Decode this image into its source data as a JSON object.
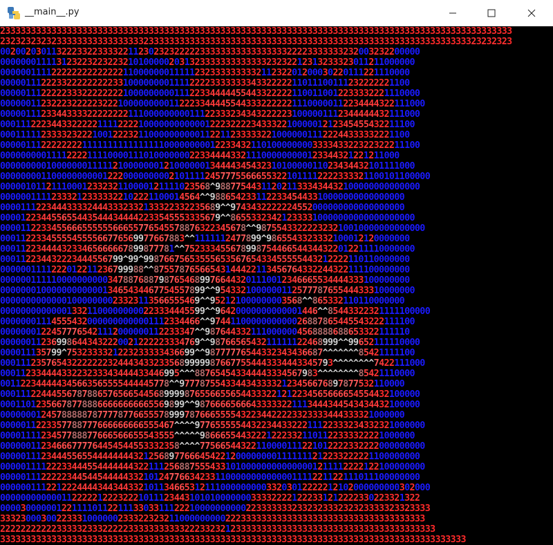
{
  "window": {
    "title": "__main__.py",
    "icon": "python-icon",
    "controls": {
      "minimize": "minimize-icon",
      "maximize": "maximize-icon",
      "close": "close-icon"
    }
  },
  "colors": {
    "background": "#000000",
    "low_digit": "#1a1aff",
    "high_digit": "#ff2a2a",
    "peak_digit": "#d0d0d0"
  },
  "grid": {
    "rows": [
      "2333333333333333333333333333333333333333333333333333333333333333333333333333333333333333333333333333",
      "2323232323233333333333333333233333333333333333333333333333333333333333333333333333333333333323232323",
      "0020020301132223322333322112302323222223333333333333333322223333333232003232200000",
      "000000011113123223223223210100000203132333333333333323232212313233323011211000000",
      "00000011112222222222222211000000011111232333333333211232201200030220111221110000",
      "00000111222332222222223310000000011112222333333334332222211011100111232222221100",
      "0000011122222333222222221000000000111223344444554433222221100110012233332221110000",
      "00000011232223222223222100000000011222334444554433322222211100000112234444322111000",
      "0000011123344333322222222111000000000111223332343432222231000001112344444432111000",
      "000111222344332222211112222100000000000012223222234333221000001212345455432211100",
      "00011111233332322210012223211000000000011221123333322100000011122244333332221100",
      "0000011122222222111111111111111100000000012233432110100000000333343322322322211100",
      "000000000111122221111000011101000000022334444332111000000000123344321221211000",
      "000000000100000001111121000000012100000013444434543231010000011023434432101111000",
      "000000001100000000001222000000000210111124577755666553221011112222333321100101100000",
      "00000101121110001233232110000121111023568^9887754431120211333434432100000000000000",
      "000000111123332123333322102221100014564^^98865423311223345443310000000000000000",
      "0000111223444333324443332332133322332235689^^9743432222224552000000000000000000",
      "0000122344556554435444344442233545553335679^^865533234212333310000000000000000000",
      "000011223345566655555566655776545578876322345678^^987554332222323210010000000000000",
      "000112233455554555566776569977667883^^1111112477899^9865543323332100012120000000",
      "0001122344443233465666667899877781^^752333455678998754466544344322012211110000000",
      "000112234432223444556799^99^9987667565355565356765433455555443212222110110000000",
      "0000001111222012211236799988^^87557876566543144422113456764332244322111100000000",
      "00000011111000000000034788768879876546899766443201110012346665534444333100000000",
      "0000000100000000000013465434467754557899^^954332100000011257778765544433310000000",
      "000000000000010000000023323113566555469^^952121000000003568^^865332110110000000",
      "0000000000000133211000000000223334445599^^96420000000000001446^^85443322321111100000",
      "000000011145554320000000000001112334466^^9744110000000000026887865445543222111100",
      "00000001224577765421112000000112233347^^9876443321110000004568888688653322111110",
      "000000112369986443432220021222223334769^^9876656543211111122468999^^99652111110000",
      "000011135799^7532333321223233333436699^^98777776544332343436687^^^^^^^85421111100",
      "00011123576543222222232444343323356899999876677554443334443345793^^^^^^^^7422111000",
      "00011233444433223233343444433446995^^^887654543344443334567983^^^^^^^^85421110000",
      "001122344444345663565555444445778^^97778755433443433332123456676897877532110000",
      "0001112244455678788657656654456899998765566556544333221212234565666654554432100000",
      "000110123566787788866666666665569899^^98766665666433333221113444344543434432100000",
      "0000000124578888878777787766555789997876665555432234422223323333444333321000000",
      "0000011223357788777666666666555467^^^^977655555443223443322211122333234332321000000",
      "0000111123457788877666566655543555^^^^^986665544322212223321101122333322221000000",
      "00000011234666777764454544553332358^^^^77566544322110000111221012222332222000000000",
      "0000011123444556554444444432125689776664542212000000001111111212233222221100000000",
      "00000111122233444554444444322111256887555433101000000000000001211112222122100000000",
      "0000011122222344544544444332101247766342331100000000000001111221122111011100000000",
      "000000111221222444434434433210113466531211100000000033203012222212102000000000302000",
      "0000000000001122222122232221011123443101010000000333322221222331212222330223321322",
      "000030000001221111011221113303311122210000000000223333333233232333232323333323323333",
      "33323000300223331000000233322323211000000000222333333333333333333333333333333333333",
      "2222222222233333233322222333333333332223323212333333333333333333333333333333333333333",
      "3333333333333333333333333333333333333333333333333333333333333333333333333333333333333333333"
    ]
  }
}
